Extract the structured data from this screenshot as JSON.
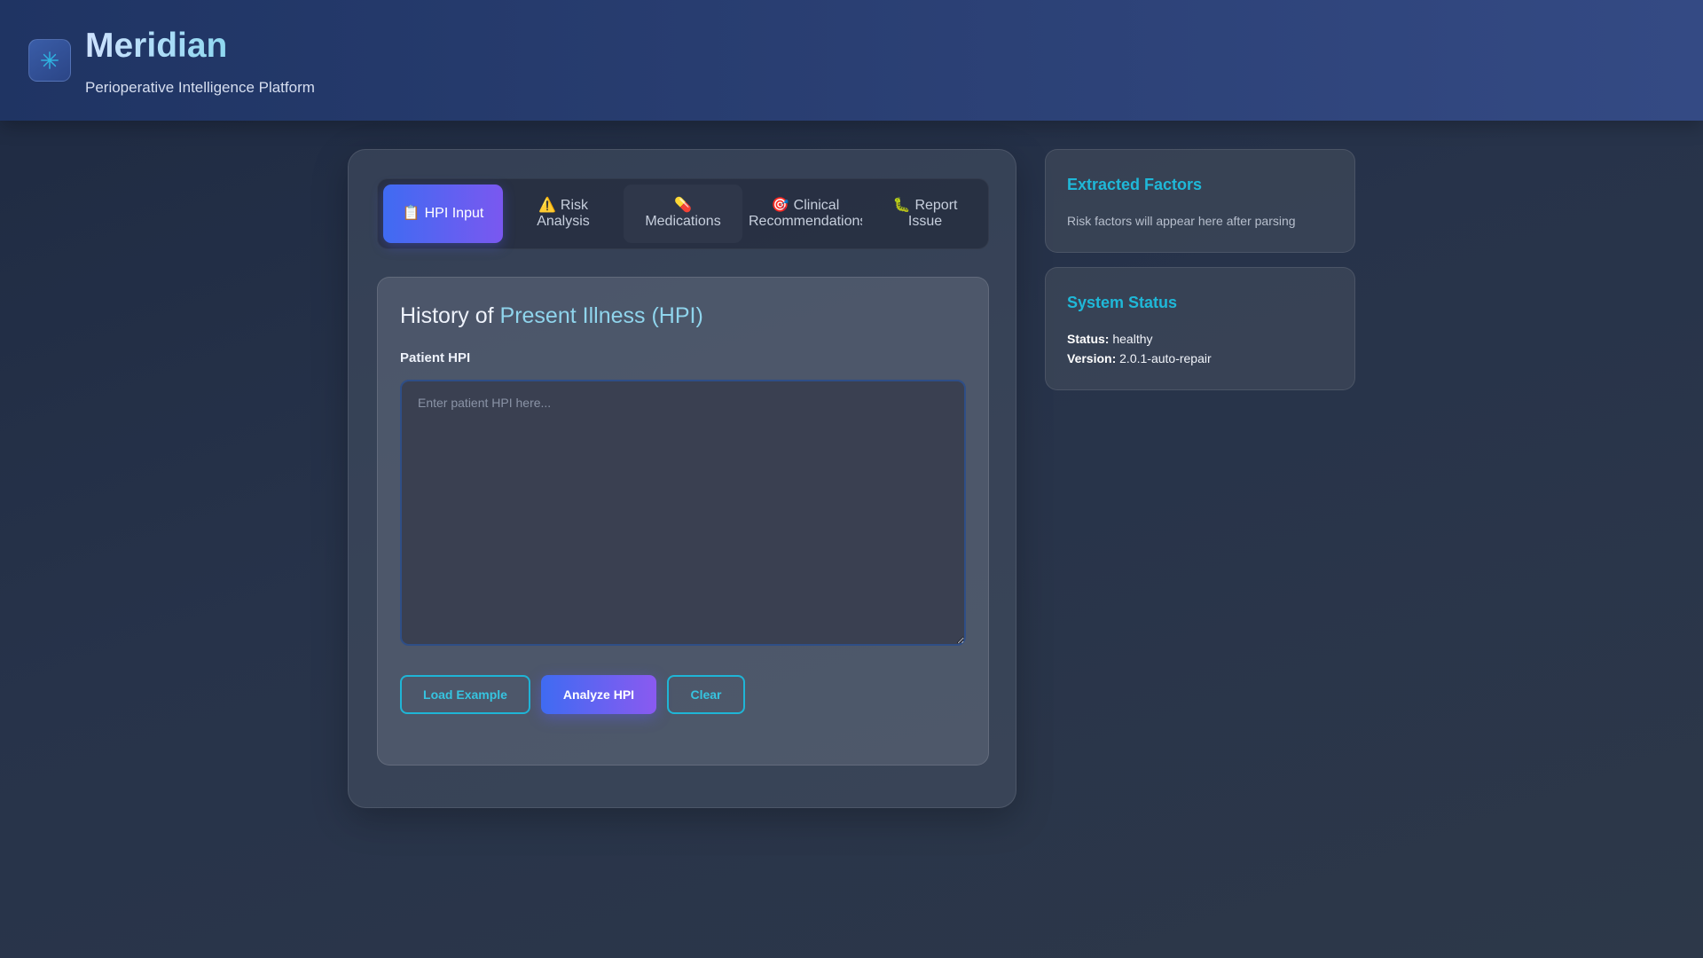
{
  "header": {
    "title": "Meridian",
    "subtitle": "Perioperative Intelligence Platform",
    "logo_icon": "sparkle-icon"
  },
  "tabs": [
    {
      "id": "hpi",
      "icon": "📋",
      "line1": "HPI Input",
      "line2": "",
      "active": true
    },
    {
      "id": "risk",
      "icon": "⚠️",
      "line1": "Risk",
      "line2": "Analysis",
      "active": false
    },
    {
      "id": "meds",
      "icon": "💊",
      "line1": "",
      "line2": "Medications",
      "active": false
    },
    {
      "id": "clinical",
      "icon": "🎯",
      "line1": "Clinical",
      "line2": "Recommendations",
      "active": false
    },
    {
      "id": "report",
      "icon": "🐛",
      "line1": "Report",
      "line2": "Issue",
      "active": false
    }
  ],
  "hpi_section": {
    "title_part1": "History of ",
    "title_part2": "Present Illness (HPI)",
    "field_label": "Patient HPI",
    "placeholder": "Enter patient HPI here...",
    "value": ""
  },
  "buttons": {
    "load_example": "Load Example",
    "analyze": "Analyze HPI",
    "clear": "Clear"
  },
  "extracted_factors": {
    "title": "Extracted Factors",
    "empty_text": "Risk factors will appear here after parsing"
  },
  "system_status": {
    "title": "System Status",
    "status_label": "Status:",
    "status_value": "healthy",
    "version_label": "Version:",
    "version_value": "2.0.1-auto-repair"
  },
  "colors": {
    "accent_cyan": "#1fb8d8",
    "primary_gradient_start": "#3f6bf2",
    "primary_gradient_end": "#8a5af0",
    "header_bg": "#2a3f73"
  }
}
